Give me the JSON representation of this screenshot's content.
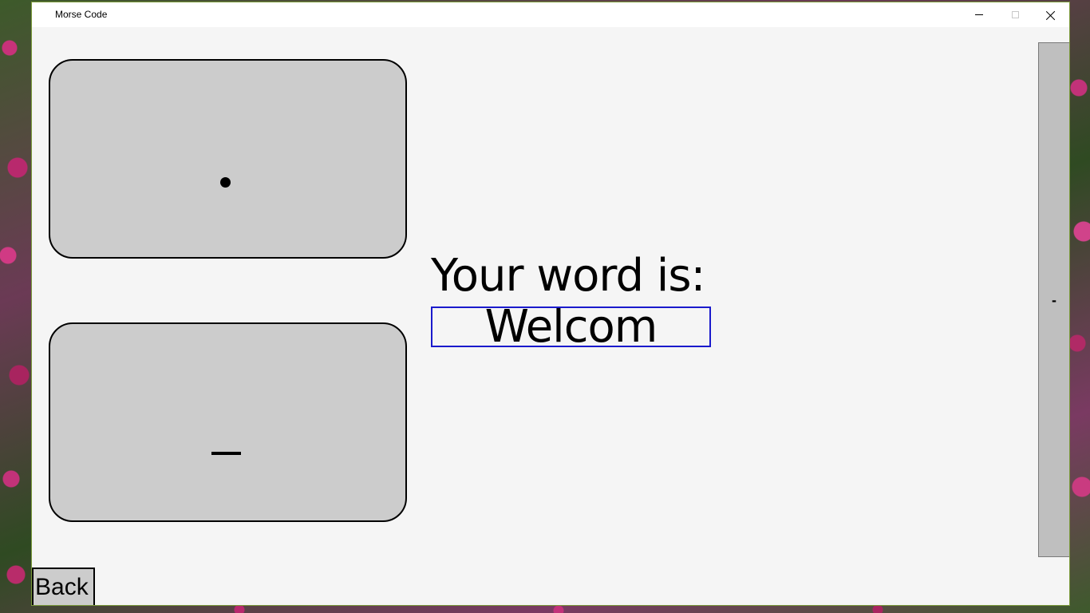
{
  "window": {
    "title": "Morse Code",
    "accent_color": "#7a9a3a"
  },
  "titlebar": {
    "minimize_icon": "minimize-icon",
    "maximize_icon": "maximize-icon",
    "close_icon": "close-icon"
  },
  "keys": {
    "dot_icon": "dot-icon",
    "dash_icon": "dash-icon",
    "key_color": "#cccccc"
  },
  "main": {
    "prompt": "Your word is:",
    "word_value": "Welcom",
    "word_border_color": "#1a1acc"
  },
  "side_button": {
    "label": "-"
  },
  "footer": {
    "back_label": "Back"
  }
}
